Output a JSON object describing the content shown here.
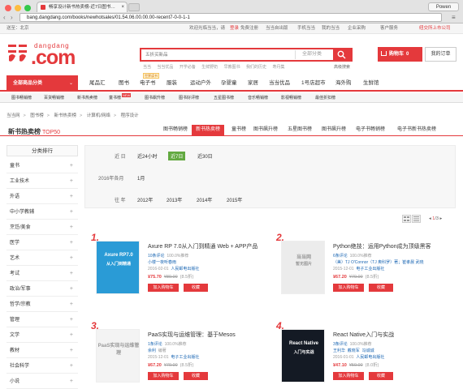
{
  "browser": {
    "tab_title": "畅享设计新书热卖榜-近7日图书…",
    "user": "Powen",
    "url": "bang.dangdang.com/books/newhotsales/01.54.06.00.00.00-recent7-0-0-1-1"
  },
  "topbar": {
    "deliver": "送至：北京",
    "welcome_pre": "欢迎光临当当，请",
    "login": "登录",
    "register": "免费注册",
    "links": [
      "当当自出版",
      "手机当当",
      "我的当当",
      "企业采购",
      "客户服务"
    ],
    "ipo": "纽交所上市公司"
  },
  "logo": {
    "small": "dangdang",
    "big": ".com"
  },
  "search": {
    "placeholder": "五折买新品",
    "category": "全部分类",
    "hotwords": [
      "当当",
      "当当优品",
      "开学必备",
      "生鲜野奶",
      "早教图书",
      "我们的历史",
      "寿丹集"
    ],
    "advanced": "高级搜索"
  },
  "cart": {
    "label": "购物车",
    "count": "0",
    "order": "我的订单"
  },
  "nav": {
    "all_categories": "全部商品分类",
    "items": [
      "尾品汇",
      "图书",
      "电子书",
      "服装",
      "运动户外",
      "孕婴童",
      "家居",
      "当当优品",
      "1号店超市",
      "海外购",
      "生鲜馆"
    ],
    "ebook_tag": "世界读书"
  },
  "subnav": [
    "图书畅销榜",
    "百货畅销榜",
    "新书热卖榜",
    "童书榜",
    "图书飙升榜",
    "图书好评榜",
    "五星图书榜",
    "音乐畅销榜",
    "影视畅销榜",
    "最佳折扣榜"
  ],
  "subnav_new": "NEW",
  "breadcrumb": [
    "当当网",
    "图书榜",
    "新书热卖榜",
    "计算机/网络",
    "程序设计"
  ],
  "rank_heading": {
    "title": "新书热卖榜",
    "sub": "TOP50"
  },
  "rank_tabs": [
    "图书畅销榜",
    "新书热卖榜",
    "童书榜",
    "图书飙升榜",
    "五星图书榜",
    "图书飙升榜",
    "电子书畅销榜",
    "电子书新书热卖榜"
  ],
  "sidebar": {
    "header": "分类排行",
    "items": [
      "童书",
      "工业技术",
      "外语",
      "中小学教辅",
      "烹饪/美食",
      "医学",
      "艺术",
      "考试",
      "政治/军事",
      "哲学/宗教",
      "管理",
      "文学",
      "教材",
      "社会科学",
      "小说"
    ]
  },
  "filter": {
    "row1_label": "近 日",
    "row1_options": [
      "近24小时",
      "近7日",
      "近30日"
    ],
    "row1_selected": "近7日",
    "row2_label": "2016年各月",
    "row2_options": [
      "1月"
    ],
    "row3_label": "往 年",
    "row3_options": [
      "2012年",
      "2013年",
      "2014年",
      "2015年"
    ]
  },
  "pager": {
    "current": "1",
    "total": "/3"
  },
  "products": [
    {
      "rank": "1.",
      "title": "Axure RP 7.0从入门到精通 Web + APP产品",
      "reviews": "10条评论",
      "recommend": "100.0%推荐",
      "author": "小楼一夜听春雨",
      "date": "2016-02-01",
      "publisher": "人民邮电出版社",
      "price": "¥75.70",
      "orig": "¥89.00",
      "discount": "(8.5折)",
      "cover_lines": [
        "Axure RP7.0",
        "从入门到精通"
      ],
      "cover_color": "#2a9bd6"
    },
    {
      "rank": "2.",
      "title": "Python绝技：运用Python成为顶级黑客",
      "reviews": "6条评论",
      "recommend": "100.0%推荐",
      "author": "（美）TJ O'Connor（TJ 奥科罗）著；崔孝晨 武晓",
      "date": "2015-12-01",
      "publisher": "电子工业出版社",
      "price": "¥67.20",
      "orig": "¥79.00",
      "discount": "(8.5折)",
      "cover_lines": [
        "当当网",
        "暂无图片"
      ],
      "cover_color": "#ececec"
    },
    {
      "rank": "3.",
      "title": "PaaS实现与运维管理：基于Mesos",
      "reviews": "1条评论",
      "recommend": "100.0%推荐",
      "author": "余利",
      "author_role": "编著",
      "date": "2015-12-01",
      "publisher": "电子工业出版社",
      "price": "¥67.20",
      "orig": "¥79.00",
      "discount": "(8.5折)",
      "cover_lines": [
        "PaaS实现与运维管理"
      ],
      "cover_color": "#f3f3f3"
    },
    {
      "rank": "4.",
      "title": "React Native入门与实战",
      "reviews": "3条评论",
      "recommend": "100.0%推荐",
      "author": "王利华",
      "author2": "戴晓军",
      "author3": "冯诚诚",
      "date": "2016-01-01",
      "publisher": "人民邮电出版社",
      "price": "¥47.10",
      "orig": "¥59.00",
      "discount": "(8.0折)",
      "cover_lines": [
        "React Native",
        "入门与实战"
      ],
      "cover_color": "#141a24"
    }
  ],
  "buttons": {
    "cart": "加入购物车",
    "fav": "收藏"
  }
}
